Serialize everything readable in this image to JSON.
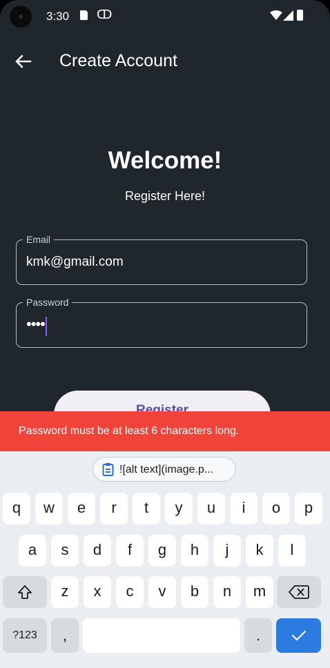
{
  "status_bar": {
    "time": "3:30"
  },
  "app_bar": {
    "title": "Create Account",
    "back_icon": "arrow-left-icon"
  },
  "header": {
    "welcome": "Welcome!",
    "subtitle": "Register Here!"
  },
  "email_field": {
    "label": "Email",
    "value": "kmk@gmail.com"
  },
  "password_field": {
    "label": "Password",
    "masked_value": "••••"
  },
  "register_button": {
    "label": "Register"
  },
  "snackbar": {
    "message": "Password must be at least 6 characters long.",
    "color": "#f0443a"
  },
  "keyboard": {
    "clipboard_suggestion": "![alt text](image.p...",
    "row1": [
      "q",
      "w",
      "e",
      "r",
      "t",
      "y",
      "u",
      "i",
      "o",
      "p"
    ],
    "row2": [
      "a",
      "s",
      "d",
      "f",
      "g",
      "h",
      "j",
      "k",
      "l"
    ],
    "row3": [
      "z",
      "x",
      "c",
      "v",
      "b",
      "n",
      "m"
    ],
    "symbols_label": "?123",
    "comma": ",",
    "period": ".",
    "enter_color": "#2b7be0"
  }
}
